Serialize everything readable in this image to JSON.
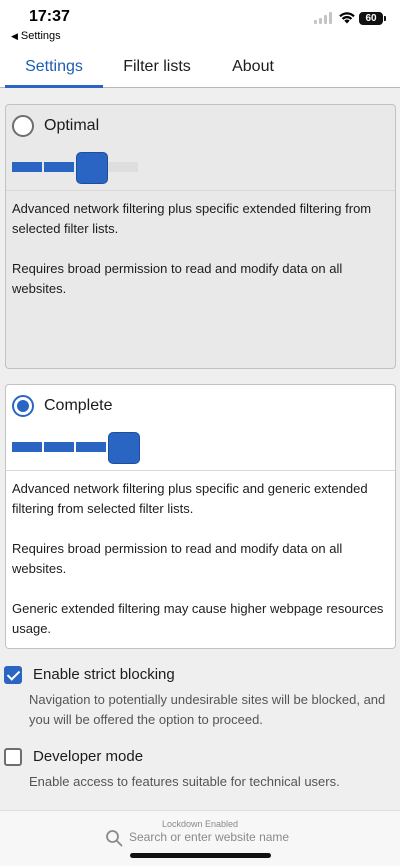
{
  "status_bar": {
    "time": "17:37",
    "back_label": "Settings",
    "battery": "60"
  },
  "tabs": [
    {
      "label": "Settings",
      "active": true
    },
    {
      "label": "Filter lists",
      "active": false
    },
    {
      "label": "About",
      "active": false
    }
  ],
  "modes": {
    "optimal": {
      "label": "Optimal",
      "selected": false,
      "level": "3 of 4",
      "description": [
        "Advanced network filtering plus specific extended filtering from selected filter lists.",
        "Requires broad permission to read and modify data on all websites."
      ]
    },
    "complete": {
      "label": "Complete",
      "selected": true,
      "level": "4 of 4",
      "description": [
        "Advanced network filtering plus specific and generic extended filtering from selected filter lists.",
        "Requires broad permission to read and modify data on all websites.",
        "Generic extended filtering may cause higher webpage resources usage."
      ]
    }
  },
  "settings": {
    "strict_blocking": {
      "label": "Enable strict blocking",
      "checked": true,
      "description": "Navigation to potentially undesirable sites will be blocked, and you will be offered the option to proceed."
    },
    "developer_mode": {
      "label": "Developer mode",
      "checked": false,
      "description": "Enable access to features suitable for technical users."
    }
  },
  "browser_bar": {
    "lockdown": "Lockdown Enabled",
    "placeholder": "Search or enter website name"
  },
  "colors": {
    "accent": "#2a65c4",
    "inactive_card_bg": "#e9e9e9"
  }
}
